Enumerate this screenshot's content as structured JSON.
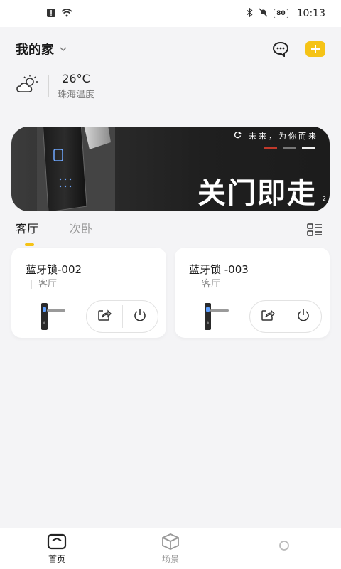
{
  "status": {
    "time": "10:13",
    "battery": "80"
  },
  "header": {
    "home_name": "我的家"
  },
  "weather": {
    "temperature": "26°C",
    "label": "珠海温度"
  },
  "banner": {
    "slogan": "未来，为你而来",
    "headline": "关门即走",
    "page": "2"
  },
  "tabs": [
    {
      "label": "客厅"
    },
    {
      "label": "次卧"
    }
  ],
  "devices": [
    {
      "name": "蓝牙锁-002",
      "room": "客厅"
    },
    {
      "name": "蓝牙锁 -003",
      "room": "客厅"
    }
  ],
  "bottom_nav": [
    {
      "label": "首页"
    },
    {
      "label": "场景"
    },
    {
      "label": ""
    }
  ],
  "colors": {
    "accent": "#f5c316",
    "background": "#f4f4f6"
  }
}
